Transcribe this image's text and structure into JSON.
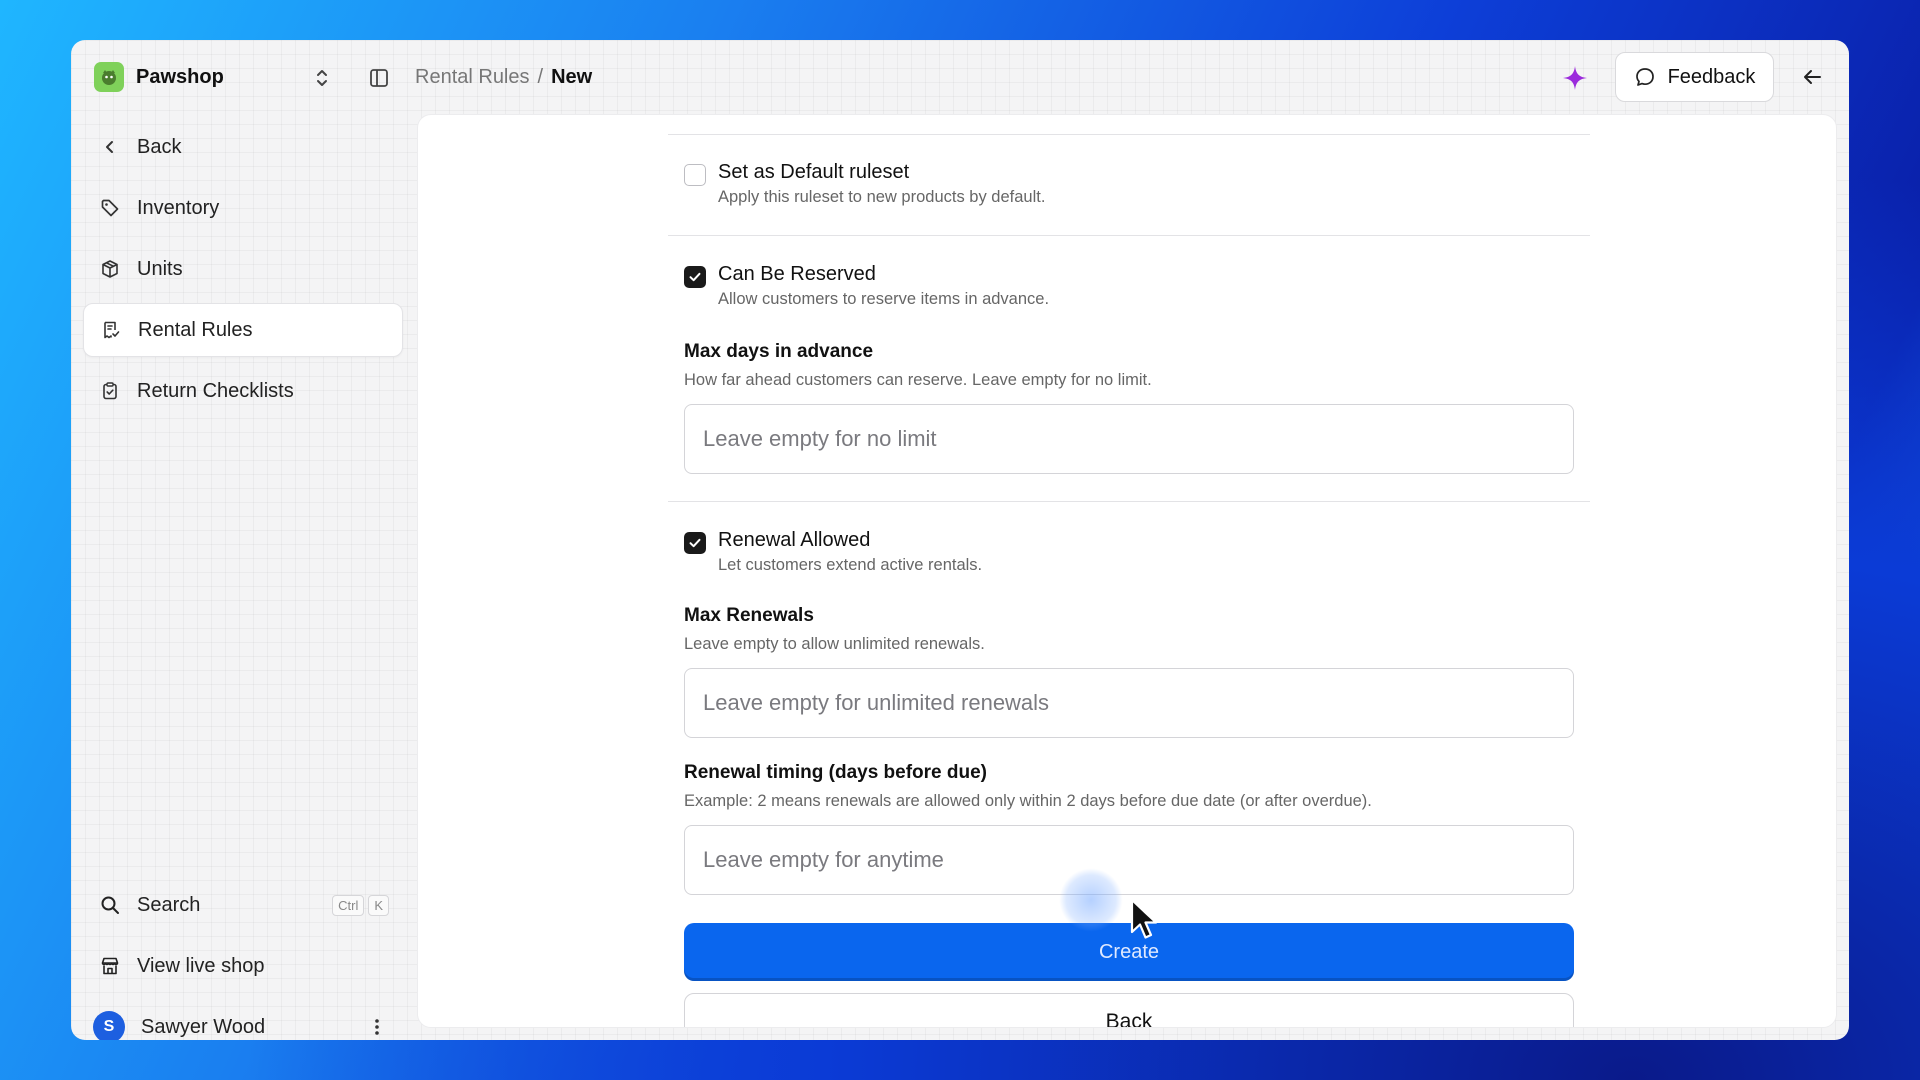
{
  "app": {
    "name": "Pawshop"
  },
  "breadcrumb": {
    "parent": "Rental Rules",
    "separator": "/",
    "current": "New"
  },
  "header": {
    "feedback_label": "Feedback"
  },
  "sidebar": {
    "items": [
      {
        "label": "Back",
        "icon": "chevron-left-icon"
      },
      {
        "label": "Inventory",
        "icon": "tag-icon"
      },
      {
        "label": "Units",
        "icon": "package-icon"
      },
      {
        "label": "Rental Rules",
        "icon": "receipt-icon",
        "active": true
      },
      {
        "label": "Return Checklists",
        "icon": "clipboard-check-icon"
      }
    ],
    "search": {
      "label": "Search",
      "shortcut": [
        "Ctrl",
        "K"
      ]
    },
    "live_shop": {
      "label": "View live shop"
    },
    "user": {
      "initial": "S",
      "name": "Sawyer Wood"
    }
  },
  "form": {
    "default_ruleset": {
      "title": "Set as Default ruleset",
      "description": "Apply this ruleset to new products by default.",
      "checked": false
    },
    "can_be_reserved": {
      "title": "Can Be Reserved",
      "description": "Allow customers to reserve items in advance.",
      "checked": true
    },
    "max_days": {
      "label": "Max days in advance",
      "help": "How far ahead customers can reserve. Leave empty for no limit.",
      "placeholder": "Leave empty for no limit",
      "value": ""
    },
    "renewal_allowed": {
      "title": "Renewal Allowed",
      "description": "Let customers extend active rentals.",
      "checked": true
    },
    "max_renewals": {
      "label": "Max Renewals",
      "help": "Leave empty to allow unlimited renewals.",
      "placeholder": "Leave empty for unlimited renewals",
      "value": ""
    },
    "renewal_timing": {
      "label": "Renewal timing (days before due)",
      "help": "Example: 2 means renewals are allowed only within 2 days before due date (or after overdue).",
      "placeholder": "Leave empty for anytime",
      "value": ""
    },
    "create_label": "Create",
    "back_label": "Back"
  },
  "colors": {
    "primary": "#0a66ee",
    "brand_logo": "#7fd15a",
    "sparkle": "#9b2bdc",
    "avatar": "#1d5fe0"
  }
}
